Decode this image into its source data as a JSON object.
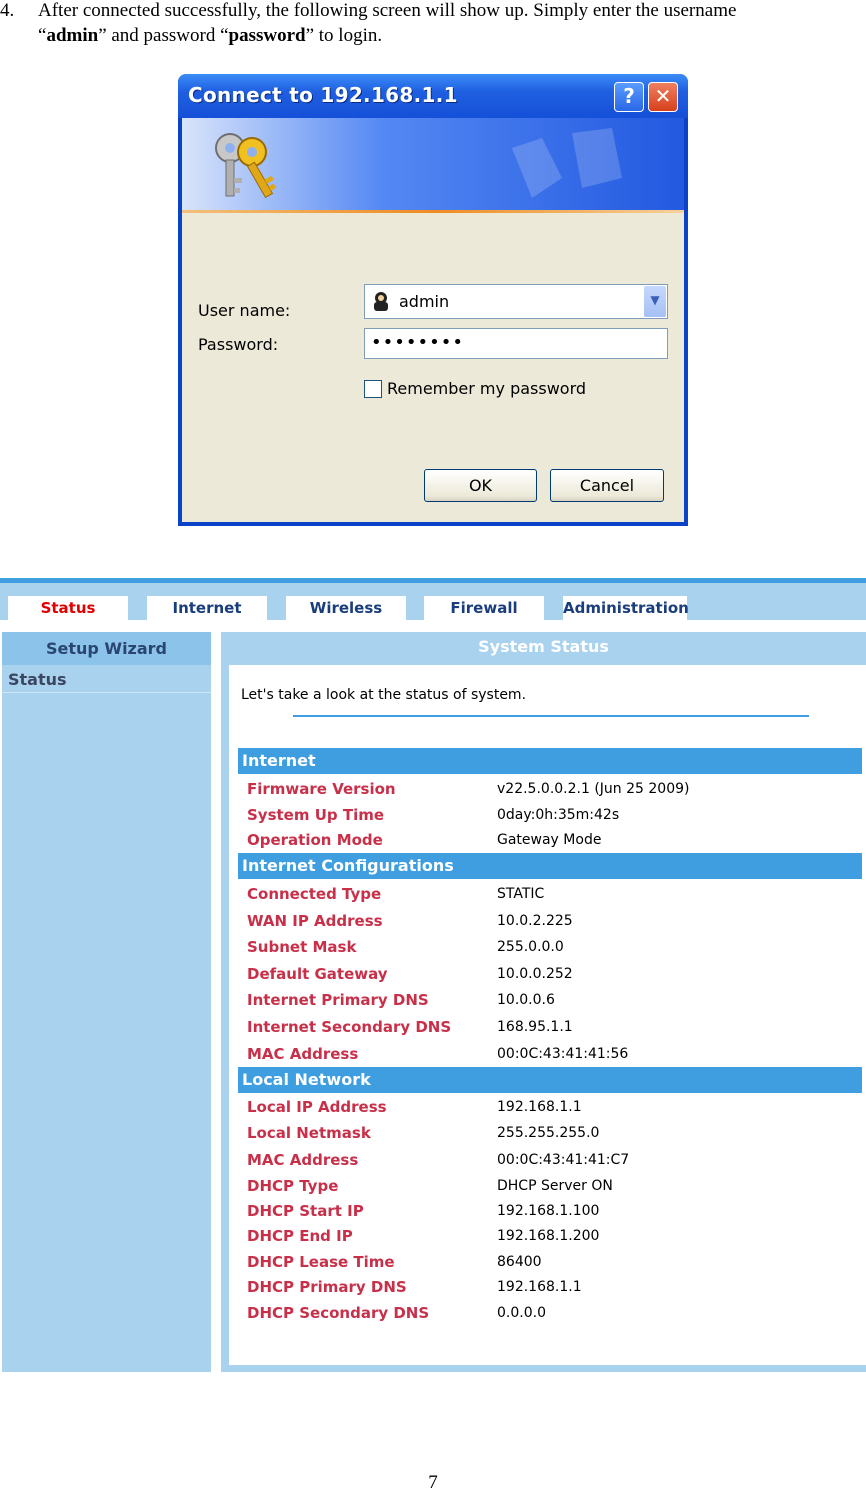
{
  "step": {
    "number": "4.",
    "text_1": "After connected successfully, the following screen will show up. Simply enter the username",
    "open_quote_1": "“",
    "user_value": "admin",
    "mid_text": "” and password “",
    "pass_value": "password",
    "end_text": "” to login."
  },
  "dialog": {
    "title": "Connect to 192.168.1.1",
    "help_label": "?",
    "close_label": "✕",
    "username_label": "User name:",
    "username_value": "admin",
    "password_label": "Password:",
    "password_value": "••••••••",
    "remember_label": "Remember my password",
    "ok_label": "OK",
    "cancel_label": "Cancel"
  },
  "router": {
    "nav_tabs": [
      "Status",
      "Internet",
      "Wireless",
      "Firewall",
      "Administration"
    ],
    "active_tab": "Status",
    "sidebar": {
      "header": "Setup Wizard",
      "item": "Status"
    },
    "main_title": "System Status",
    "intro": "Let's take a look at the status of system.",
    "sections": [
      {
        "title": "Internet",
        "rows": [
          {
            "label": "Firmware Version",
            "value": "v22.5.0.0.2.1 (Jun 25 2009)"
          },
          {
            "label": "System Up Time",
            "value": "0day:0h:35m:42s"
          },
          {
            "label": "Operation Mode",
            "value": "Gateway Mode"
          }
        ]
      },
      {
        "title": "Internet Configurations",
        "rows": [
          {
            "label": "Connected Type",
            "value": "STATIC"
          },
          {
            "label": "WAN IP Address",
            "value": "10.0.2.225"
          },
          {
            "label": "Subnet Mask",
            "value": "255.0.0.0"
          },
          {
            "label": "Default Gateway",
            "value": "10.0.0.252"
          },
          {
            "label": "Internet Primary DNS",
            "value": "10.0.0.6"
          },
          {
            "label": "Internet Secondary DNS",
            "value": "168.95.1.1"
          },
          {
            "label": "MAC Address",
            "value": "00:0C:43:41:41:56"
          }
        ]
      },
      {
        "title": "Local Network",
        "rows": [
          {
            "label": "Local IP Address",
            "value": "192.168.1.1"
          },
          {
            "label": "Local Netmask",
            "value": "255.255.255.0"
          },
          {
            "label": "MAC Address",
            "value": "00:0C:43:41:41:C7"
          },
          {
            "label": "DHCP Type",
            "value": "DHCP Server ON"
          },
          {
            "label": "DHCP Start IP",
            "value": "192.168.1.100"
          },
          {
            "label": "DHCP End IP",
            "value": "192.168.1.200"
          },
          {
            "label": "DHCP Lease Time",
            "value": "86400"
          },
          {
            "label": "DHCP Primary DNS",
            "value": "192.168.1.1"
          },
          {
            "label": "DHCP Secondary DNS",
            "value": "0.0.0.0"
          }
        ]
      }
    ]
  },
  "page_number": "7",
  "colors": {
    "router_light": "#a9d2ef",
    "router_accent": "#3f9ee0",
    "label_red": "#c8304a",
    "active_tab": "#e00000",
    "xp_blue": "#0a42c8"
  }
}
